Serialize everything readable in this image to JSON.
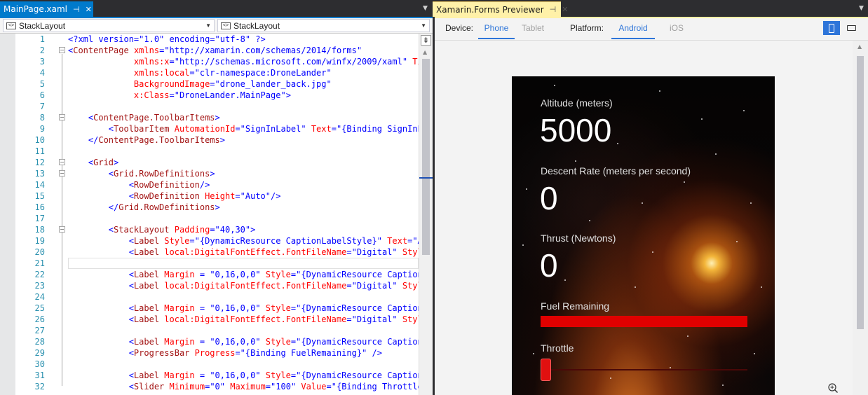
{
  "tabs": {
    "editor": {
      "title": "MainPage.xaml",
      "pin": "⊣",
      "close": "✕"
    },
    "previewer": {
      "title": "Xamarin.Forms Previewer",
      "pin": "⊣",
      "close": "✕"
    }
  },
  "navbar": {
    "left_combo": "StackLayout",
    "right_combo": "StackLayout"
  },
  "editor": {
    "current_line": 21,
    "lines": [
      {
        "n": "1",
        "tokens": [
          [
            "d",
            "<?xml version=\"1.0\" encoding=\"utf-8\" ?>"
          ]
        ]
      },
      {
        "n": "2",
        "tokens": [
          [
            "d",
            "<"
          ],
          [
            "e",
            "ContentPage"
          ],
          [
            "a",
            " xmlns"
          ],
          [
            "d",
            "="
          ],
          [
            "v",
            "\"http://xamarin.com/schemas/2014/forms\""
          ]
        ]
      },
      {
        "n": "3",
        "tokens": [
          [
            "a",
            "             xmlns:x"
          ],
          [
            "d",
            "="
          ],
          [
            "v",
            "\"http://schemas.microsoft.com/winfx/2009/xaml\""
          ],
          [
            "a",
            " Title"
          ]
        ]
      },
      {
        "n": "4",
        "tokens": [
          [
            "a",
            "             xmlns:local"
          ],
          [
            "d",
            "="
          ],
          [
            "v",
            "\"clr-namespace:DroneLander\""
          ]
        ]
      },
      {
        "n": "5",
        "tokens": [
          [
            "a",
            "             BackgroundImage"
          ],
          [
            "d",
            "="
          ],
          [
            "v",
            "\"drone_lander_back.jpg\""
          ]
        ]
      },
      {
        "n": "6",
        "tokens": [
          [
            "a",
            "             x:Class"
          ],
          [
            "d",
            "="
          ],
          [
            "v",
            "\"DroneLander.MainPage\""
          ],
          [
            "d",
            ">"
          ]
        ]
      },
      {
        "n": "7",
        "tokens": []
      },
      {
        "n": "8",
        "tokens": [
          [
            "d",
            "    <"
          ],
          [
            "e",
            "ContentPage.ToolbarItems"
          ],
          [
            "d",
            ">"
          ]
        ]
      },
      {
        "n": "9",
        "tokens": [
          [
            "d",
            "        <"
          ],
          [
            "e",
            "ToolbarItem"
          ],
          [
            "a",
            " AutomationId"
          ],
          [
            "d",
            "="
          ],
          [
            "v",
            "\"SignInLabel\""
          ],
          [
            "a",
            " Text"
          ],
          [
            "d",
            "="
          ],
          [
            "v",
            "\"{Binding SignInLabel"
          ]
        ]
      },
      {
        "n": "10",
        "tokens": [
          [
            "d",
            "    </"
          ],
          [
            "e",
            "ContentPage.ToolbarItems"
          ],
          [
            "d",
            ">"
          ]
        ]
      },
      {
        "n": "11",
        "tokens": []
      },
      {
        "n": "12",
        "tokens": [
          [
            "d",
            "    <"
          ],
          [
            "e",
            "Grid"
          ],
          [
            "d",
            ">"
          ]
        ]
      },
      {
        "n": "13",
        "tokens": [
          [
            "d",
            "        <"
          ],
          [
            "e",
            "Grid.RowDefinitions"
          ],
          [
            "d",
            ">"
          ]
        ]
      },
      {
        "n": "14",
        "tokens": [
          [
            "d",
            "            <"
          ],
          [
            "e",
            "RowDefinition"
          ],
          [
            "d",
            "/>"
          ]
        ]
      },
      {
        "n": "15",
        "tokens": [
          [
            "d",
            "            <"
          ],
          [
            "e",
            "RowDefinition"
          ],
          [
            "a",
            " Height"
          ],
          [
            "d",
            "="
          ],
          [
            "v",
            "\"Auto\""
          ],
          [
            "d",
            "/>"
          ]
        ]
      },
      {
        "n": "16",
        "tokens": [
          [
            "d",
            "        </"
          ],
          [
            "e",
            "Grid.RowDefinitions"
          ],
          [
            "d",
            ">"
          ]
        ]
      },
      {
        "n": "17",
        "tokens": []
      },
      {
        "n": "18",
        "tokens": [
          [
            "d",
            "        <"
          ],
          [
            "e",
            "StackLayout"
          ],
          [
            "a",
            " Padding"
          ],
          [
            "d",
            "="
          ],
          [
            "v",
            "\"40,30\""
          ],
          [
            "d",
            ">"
          ]
        ]
      },
      {
        "n": "19",
        "tokens": [
          [
            "d",
            "            <"
          ],
          [
            "e",
            "Label"
          ],
          [
            "a",
            " Style"
          ],
          [
            "d",
            "="
          ],
          [
            "v",
            "\"{DynamicResource CaptionLabelStyle}\""
          ],
          [
            "a",
            " Text"
          ],
          [
            "d",
            "="
          ],
          [
            "v",
            "\"Altitude (meters)\""
          ]
        ]
      },
      {
        "n": "20",
        "tokens": [
          [
            "d",
            "            <"
          ],
          [
            "e",
            "Label"
          ],
          [
            "a",
            " local:DigitalFontEffect.FontFileName"
          ],
          [
            "d",
            "="
          ],
          [
            "v",
            "\"Digital\""
          ],
          [
            "a",
            " Style"
          ],
          [
            "d",
            "="
          ]
        ]
      },
      {
        "n": "21",
        "tokens": []
      },
      {
        "n": "22",
        "tokens": [
          [
            "d",
            "            <"
          ],
          [
            "e",
            "Label"
          ],
          [
            "a",
            " Margin"
          ],
          [
            "d",
            " = "
          ],
          [
            "v",
            "\"0,16,0,0\""
          ],
          [
            "a",
            " Style"
          ],
          [
            "d",
            "="
          ],
          [
            "v",
            "\"{DynamicResource CaptionLa"
          ]
        ]
      },
      {
        "n": "23",
        "tokens": [
          [
            "d",
            "            <"
          ],
          [
            "e",
            "Label"
          ],
          [
            "a",
            " local:DigitalFontEffect.FontFileName"
          ],
          [
            "d",
            "="
          ],
          [
            "v",
            "\"Digital\""
          ],
          [
            "a",
            " Style"
          ],
          [
            "d",
            "="
          ]
        ]
      },
      {
        "n": "24",
        "tokens": []
      },
      {
        "n": "25",
        "tokens": [
          [
            "d",
            "            <"
          ],
          [
            "e",
            "Label"
          ],
          [
            "a",
            " Margin"
          ],
          [
            "d",
            " = "
          ],
          [
            "v",
            "\"0,16,0,0\""
          ],
          [
            "a",
            " Style"
          ],
          [
            "d",
            "="
          ],
          [
            "v",
            "\"{DynamicResource CaptionLa"
          ]
        ]
      },
      {
        "n": "26",
        "tokens": [
          [
            "d",
            "            <"
          ],
          [
            "e",
            "Label"
          ],
          [
            "a",
            " local:DigitalFontEffect.FontFileName"
          ],
          [
            "d",
            "="
          ],
          [
            "v",
            "\"Digital\""
          ],
          [
            "a",
            " Style"
          ],
          [
            "d",
            "="
          ]
        ]
      },
      {
        "n": "27",
        "tokens": []
      },
      {
        "n": "28",
        "tokens": [
          [
            "d",
            "            <"
          ],
          [
            "e",
            "Label"
          ],
          [
            "a",
            " Margin"
          ],
          [
            "d",
            " = "
          ],
          [
            "v",
            "\"0,16,0,0\""
          ],
          [
            "a",
            " Style"
          ],
          [
            "d",
            "="
          ],
          [
            "v",
            "\"{DynamicResource CaptionLa"
          ]
        ]
      },
      {
        "n": "29",
        "tokens": [
          [
            "d",
            "            <"
          ],
          [
            "e",
            "ProgressBar"
          ],
          [
            "a",
            " Progress"
          ],
          [
            "d",
            "="
          ],
          [
            "v",
            "\"{Binding FuelRemaining}\""
          ],
          [
            "d",
            " />"
          ]
        ]
      },
      {
        "n": "30",
        "tokens": []
      },
      {
        "n": "31",
        "tokens": [
          [
            "d",
            "            <"
          ],
          [
            "e",
            "Label"
          ],
          [
            "a",
            " Margin"
          ],
          [
            "d",
            " = "
          ],
          [
            "v",
            "\"0,16,0,0\""
          ],
          [
            "a",
            " Style"
          ],
          [
            "d",
            "="
          ],
          [
            "v",
            "\"{DynamicResource CaptionLa"
          ]
        ]
      },
      {
        "n": "32",
        "tokens": [
          [
            "d",
            "            <"
          ],
          [
            "e",
            "Slider"
          ],
          [
            "a",
            " Minimum"
          ],
          [
            "d",
            "="
          ],
          [
            "v",
            "\"0\""
          ],
          [
            "a",
            " Maximum"
          ],
          [
            "d",
            "="
          ],
          [
            "v",
            "\"100\""
          ],
          [
            "a",
            " Value"
          ],
          [
            "d",
            "="
          ],
          [
            "v",
            "\"{Binding Throttle,"
          ]
        ]
      }
    ],
    "folds": [
      2,
      8,
      12,
      13,
      18
    ]
  },
  "previewer": {
    "device_label": "Device:",
    "devices": [
      "Phone",
      "Tablet"
    ],
    "selected_device": "Phone",
    "platform_label": "Platform:",
    "platforms": [
      "Android",
      "iOS"
    ],
    "selected_platform": "Android",
    "orientation": "portrait"
  },
  "app": {
    "altitude_label": "Altitude (meters)",
    "altitude_value": "5000",
    "descent_label": "Descent Rate (meters per second)",
    "descent_value": "0",
    "thrust_label": "Thrust (Newtons)",
    "thrust_value": "0",
    "fuel_label": "Fuel Remaining",
    "fuel_fraction": 1.0,
    "throttle_label": "Throttle",
    "throttle_fraction": 0.0
  },
  "colors": {
    "accent": "#007acc",
    "preview_accent": "#2e75d9",
    "fuel": "#e00000"
  }
}
